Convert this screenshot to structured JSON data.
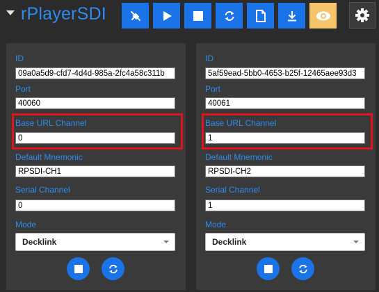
{
  "app": {
    "title": "rPlayerSDI"
  },
  "toolbar": {
    "buttons": [
      {
        "name": "plug-button",
        "icon": "plug-icon"
      },
      {
        "name": "play-button",
        "icon": "play-icon"
      },
      {
        "name": "stop-button",
        "icon": "stop-icon"
      },
      {
        "name": "refresh-button",
        "icon": "refresh-icon"
      },
      {
        "name": "file-button",
        "icon": "file-icon"
      },
      {
        "name": "download-button",
        "icon": "download-icon"
      },
      {
        "name": "visibility-button",
        "icon": "eye-icon"
      }
    ],
    "settings_icon": "gear-icon"
  },
  "colors": {
    "accent": "#1b73e8",
    "label": "#2e8cf0",
    "eye_button": "#f6c56a",
    "highlight": "#e0141e",
    "panel": "#3a3a3a",
    "background": "#2b2b2b"
  },
  "labels": {
    "id": "ID",
    "port": "Port",
    "base_url_channel": "Base URL Channel",
    "default_mnemonic": "Default Mnemonic",
    "serial_channel": "Serial Channel",
    "mode": "Mode"
  },
  "channels": [
    {
      "id": "09a0a5d9-cfd7-4d4d-985a-2fc4a58c311b",
      "port": "40060",
      "base_url_channel": "0",
      "default_mnemonic": "RPSDI-CH1",
      "serial_channel": "0",
      "mode": "Decklink"
    },
    {
      "id": "5af59ead-5bb0-4653-b25f-12465aee93d3",
      "port": "40061",
      "base_url_channel": "1",
      "default_mnemonic": "RPSDI-CH2",
      "serial_channel": "1",
      "mode": "Decklink"
    }
  ]
}
